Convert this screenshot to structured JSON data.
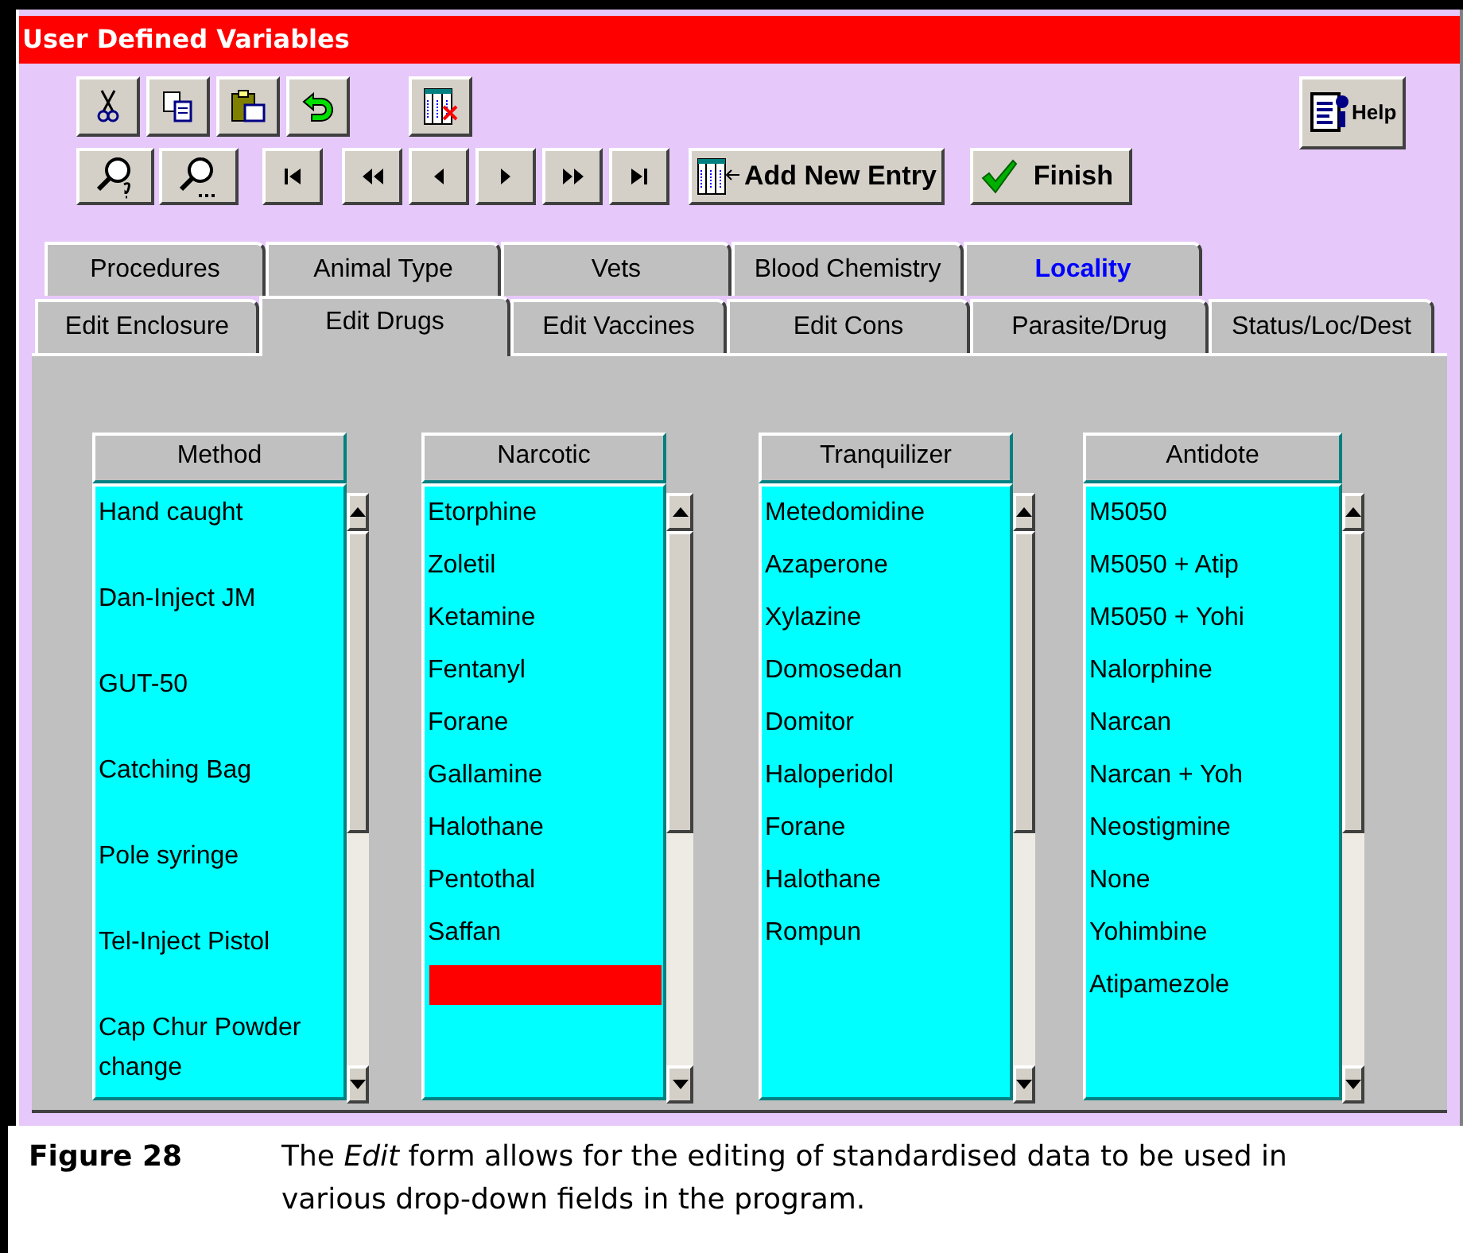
{
  "window": {
    "title": "User Defined Variables"
  },
  "toolbar": {
    "add_button": "Add New Entry",
    "finish_button": "Finish",
    "help_button": "Help"
  },
  "tab_rows": [
    {
      "tabs": [
        {
          "label": "Procedures",
          "selected": false,
          "emphasized": false
        },
        {
          "label": "Animal Type",
          "selected": false,
          "emphasized": false
        },
        {
          "label": "Vets",
          "selected": false,
          "emphasized": false
        },
        {
          "label": "Blood Chemistry",
          "selected": false,
          "emphasized": false
        },
        {
          "label": "Locality",
          "selected": false,
          "emphasized": true
        }
      ]
    },
    {
      "tabs": [
        {
          "label": "Edit Enclosure",
          "selected": false,
          "emphasized": false
        },
        {
          "label": "Edit Drugs",
          "selected": true,
          "emphasized": false
        },
        {
          "label": "Edit Vaccines",
          "selected": false,
          "emphasized": false
        },
        {
          "label": "Edit Cons",
          "selected": false,
          "emphasized": false
        },
        {
          "label": "Parasite/Drug",
          "selected": false,
          "emphasized": false
        },
        {
          "label": "Status/Loc/Dest",
          "selected": false,
          "emphasized": false
        }
      ]
    }
  ],
  "lists": [
    {
      "header": "Method",
      "kind": "tall",
      "new_entry_row": false,
      "items": [
        "Hand caught",
        "Dan-Inject JM",
        "GUT-50",
        "Catching Bag",
        "Pole syringe",
        "Tel-Inject Pistol",
        "Cap Chur Powder change"
      ]
    },
    {
      "header": "Narcotic",
      "kind": "compact",
      "new_entry_row": true,
      "items": [
        "Etorphine",
        "Zoletil",
        "Ketamine",
        "Fentanyl",
        "Forane",
        "Gallamine",
        "Halothane",
        "Pentothal",
        "Saffan"
      ]
    },
    {
      "header": "Tranquilizer",
      "kind": "compact",
      "new_entry_row": false,
      "items": [
        "Metedomidine",
        "Azaperone",
        "Xylazine",
        "Domosedan",
        "Domitor",
        "Haloperidol",
        "Forane",
        "Halothane",
        "Rompun"
      ]
    },
    {
      "header": "Antidote",
      "kind": "compact",
      "new_entry_row": false,
      "items": [
        "M5050",
        "M5050 + Atip",
        "M5050 + Yohi",
        "Nalorphine",
        "Narcan",
        "Narcan + Yoh",
        "Neostigmine",
        "None",
        "Yohimbine",
        "Atipamezole"
      ]
    }
  ],
  "caption": {
    "label": "Figure 28",
    "text": "The *Edit* form allows for the editing of standardised data to be used in various drop-down fields in the program."
  }
}
